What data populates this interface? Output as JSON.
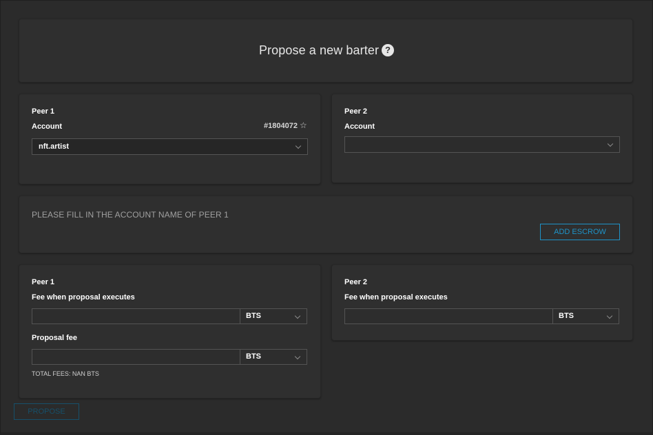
{
  "title": "Propose a new barter",
  "help_icon": "?",
  "peer1": {
    "heading": "Peer 1",
    "account_label": "Account",
    "account_id": "#1804072",
    "account_value": "nft.artist",
    "fee_label": "Fee when proposal executes",
    "fee_asset": "BTS",
    "proposal_fee_label": "Proposal fee",
    "proposal_fee_asset": "BTS",
    "total_fees": "TOTAL FEES: NAN BTS"
  },
  "peer2": {
    "heading": "Peer 2",
    "account_label": "Account",
    "account_value": "",
    "fee_label": "Fee when proposal executes",
    "fee_asset": "BTS"
  },
  "escrow": {
    "notice": "PLEASE FILL IN THE ACCOUNT NAME OF PEER 1",
    "button": "ADD ESCROW"
  },
  "propose_button": "PROPOSE",
  "colors": {
    "accent": "#1e93c8",
    "disabled_accent": "#16506b",
    "background": "#2b2b2b",
    "panel": "#2f2f2f"
  },
  "icons": {
    "help": "question-circle-icon",
    "star": "star-outline-icon",
    "chevron": "chevron-down-icon"
  }
}
